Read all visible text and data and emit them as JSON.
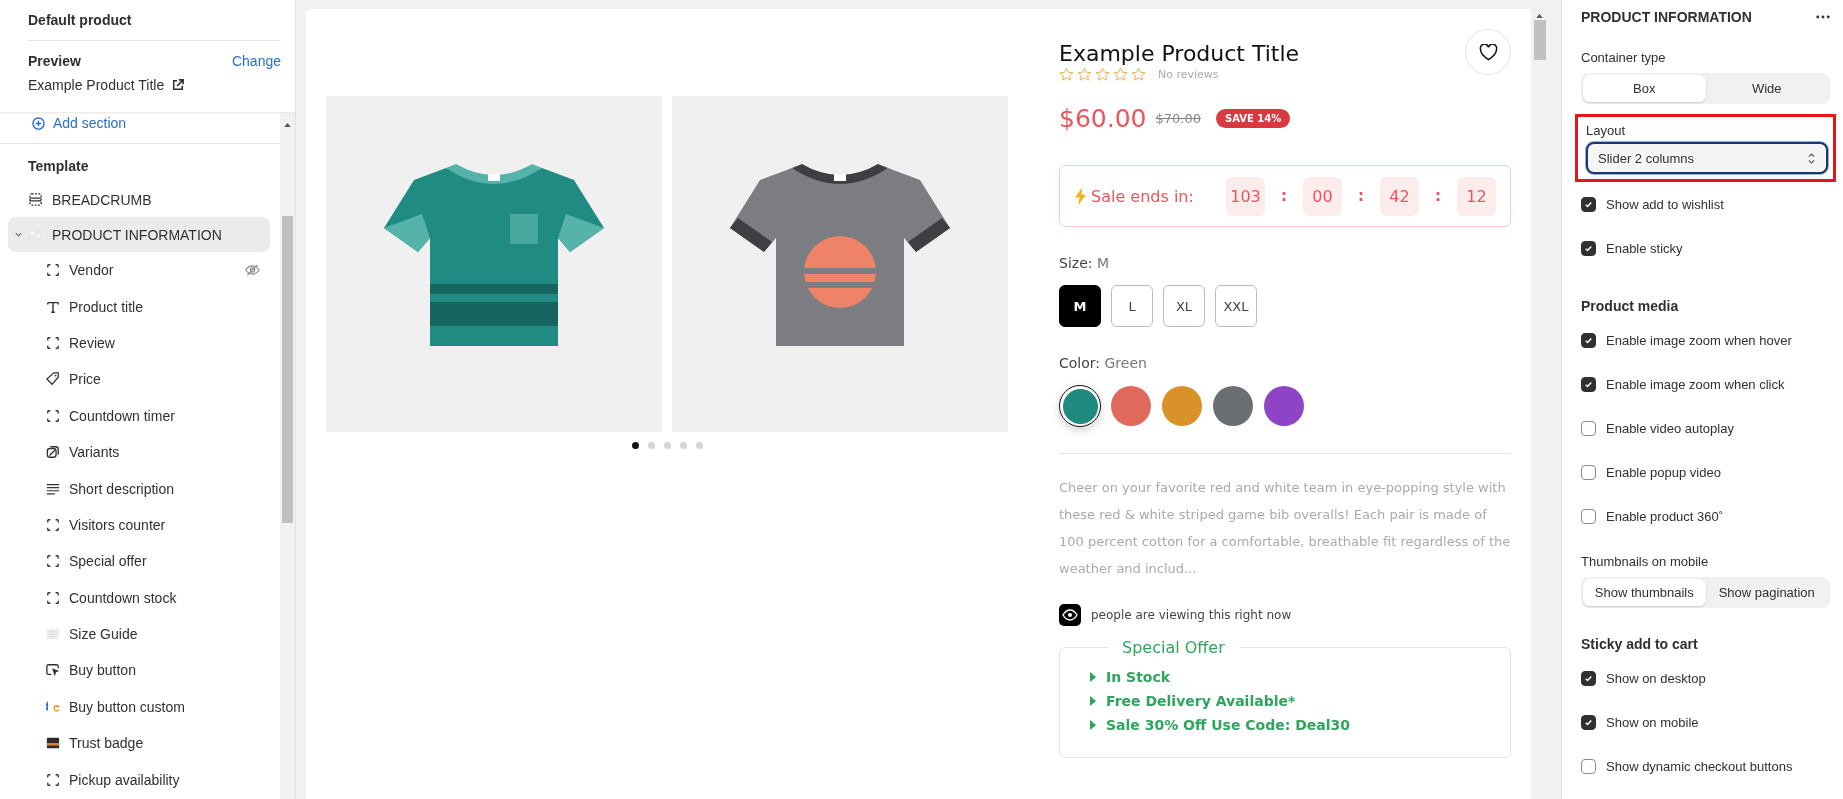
{
  "sidebar": {
    "title": "Default product",
    "preview": {
      "label": "Preview",
      "action": "Change",
      "product": "Example Product Title"
    },
    "add_section": "Add section",
    "template_label": "Template",
    "sections": [
      {
        "label": "BREADCRUMB",
        "kind": "section",
        "selected": false
      },
      {
        "label": "PRODUCT INFORMATION",
        "selected": true,
        "expanded": true,
        "children": [
          {
            "label": "Vendor",
            "kind": "block",
            "hidden": true
          },
          {
            "label": "Product title",
            "kind": "text",
            "hidden": false
          },
          {
            "label": "Review",
            "kind": "block",
            "hidden": false
          },
          {
            "label": "Price",
            "kind": "price",
            "hidden": false
          },
          {
            "label": "Countdown timer",
            "kind": "block",
            "hidden": false
          },
          {
            "label": "Variants",
            "kind": "variants",
            "hidden": false
          },
          {
            "label": "Short description",
            "kind": "lines",
            "hidden": false
          },
          {
            "label": "Visitors counter",
            "kind": "block",
            "hidden": false
          },
          {
            "label": "Special offer",
            "kind": "block",
            "hidden": false
          },
          {
            "label": "Countdown stock",
            "kind": "block",
            "hidden": false
          },
          {
            "label": "Size Guide",
            "kind": "faint",
            "hidden": false
          },
          {
            "label": "Buy button",
            "kind": "cursor",
            "hidden": false
          },
          {
            "label": "Buy button custom",
            "kind": "logo",
            "hidden": false
          },
          {
            "label": "Trust badge",
            "hidden": false
          },
          {
            "label": "Pickup availability",
            "kind": "block",
            "hidden": false
          }
        ]
      }
    ]
  },
  "product": {
    "gallery": {
      "dots": [
        {
          "selected": true
        },
        {
          "selected": false
        },
        {
          "selected": false
        },
        {
          "selected": false
        },
        {
          "selected": false
        }
      ]
    },
    "title": "Example Product Title",
    "stars": 0,
    "reviews": "No reviews",
    "price": "$60.00",
    "compare_price": "$70.00",
    "badge": "SAVE 14%",
    "countdown": {
      "label": "Sale ends in:",
      "parts": [
        {
          "kind": "value",
          "text": "103"
        },
        {
          "kind": "sep",
          "text": ":"
        },
        {
          "kind": "value",
          "text": "00"
        },
        {
          "kind": "sep",
          "text": ":"
        },
        {
          "kind": "value",
          "text": "42"
        },
        {
          "kind": "sep",
          "text": ":"
        },
        {
          "kind": "value",
          "text": "12"
        }
      ]
    },
    "size": {
      "label": "Size:",
      "value": "M",
      "options": [
        {
          "label": "M",
          "selected": true
        },
        {
          "label": "L",
          "selected": false
        },
        {
          "label": "XL",
          "selected": false
        },
        {
          "label": "XXL",
          "selected": false
        }
      ]
    },
    "color": {
      "label": "Color:",
      "value": "Green",
      "swatches": [
        {
          "color": "#1f8a80",
          "selected": true
        },
        {
          "color": "#e0695c",
          "selected": false
        },
        {
          "color": "#d9922a",
          "selected": false
        },
        {
          "color": "#6b6e73",
          "selected": false
        },
        {
          "color": "#8e44c4",
          "selected": false
        }
      ]
    },
    "description": "Cheer on your favorite red and white team in eye-popping style with these red & white striped game bib overalls! Each pair is made of 100 percent cotton for a comfortable, breathable fit regardless of the weather and includ...",
    "viewers": "people are viewing this right now",
    "offer": {
      "title": "Special Offer",
      "items": [
        "In Stock",
        "Free Delivery Available*",
        "Sale 30% Off Use Code: Deal30"
      ]
    }
  },
  "settings": {
    "title": "PRODUCT INFORMATION",
    "items": [
      {
        "kind": "label",
        "text": "Container type"
      },
      {
        "kind": "segmented",
        "options": [
          {
            "label": "Box",
            "selected": true
          },
          {
            "label": "Wide",
            "selected": false
          }
        ]
      },
      {
        "kind": "select",
        "label": "Layout",
        "value": "Slider 2 columns",
        "highlighted": true
      },
      {
        "kind": "checkbox",
        "text": "Show add to wishlist",
        "checked": true
      },
      {
        "kind": "checkbox",
        "text": "Enable sticky",
        "checked": true
      },
      {
        "kind": "heading",
        "text": "Product media"
      },
      {
        "kind": "checkbox",
        "text": "Enable image zoom when hover",
        "checked": true
      },
      {
        "kind": "checkbox",
        "text": "Enable image zoom when click",
        "checked": true
      },
      {
        "kind": "checkbox",
        "text": "Enable video autoplay",
        "checked": false
      },
      {
        "kind": "checkbox",
        "text": "Enable popup video",
        "checked": false
      },
      {
        "kind": "checkbox",
        "text": "Enable product 360˚",
        "checked": false
      },
      {
        "kind": "label",
        "text": "Thumbnails on mobile"
      },
      {
        "kind": "segmented",
        "options": [
          {
            "label": "Show thumbnails",
            "selected": true
          },
          {
            "label": "Show pagination",
            "selected": false
          }
        ]
      },
      {
        "kind": "heading",
        "text": "Sticky add to cart"
      },
      {
        "kind": "checkbox",
        "text": "Show on desktop",
        "checked": true
      },
      {
        "kind": "checkbox",
        "text": "Show on mobile",
        "checked": true
      },
      {
        "kind": "checkbox",
        "text": "Show dynamic checkout buttons",
        "checked": false
      }
    ]
  }
}
